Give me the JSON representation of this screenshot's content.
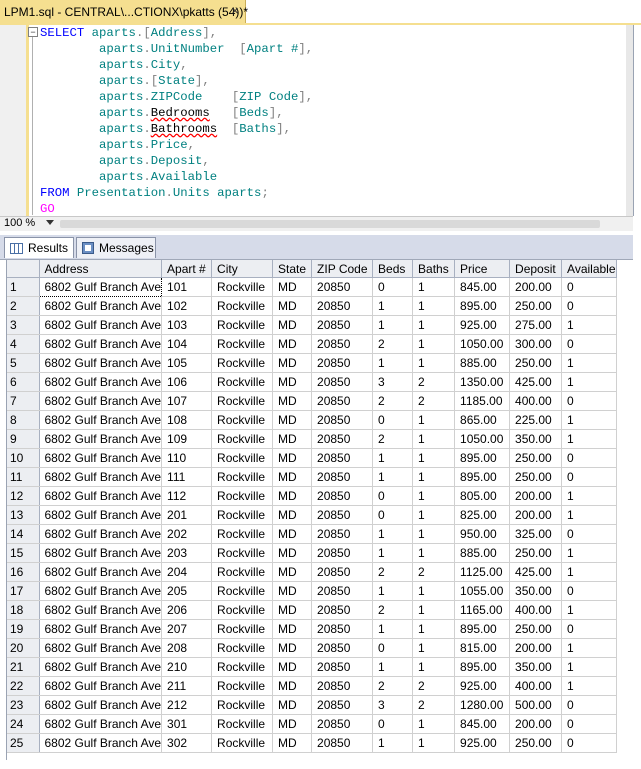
{
  "document_tab": {
    "title": "LPM1.sql - CENTRAL\\...CTIONX\\pkatts (54))*",
    "close_glyph": "×"
  },
  "editor": {
    "collapse_glyph": "−",
    "lines": [
      [
        [
          "kw",
          "SELECT "
        ],
        [
          "id",
          "aparts"
        ],
        [
          "pun",
          "."
        ],
        [
          "pun",
          "["
        ],
        [
          "id",
          "Address"
        ],
        [
          "pun",
          "],"
        ]
      ],
      [
        [
          "",
          "        "
        ],
        [
          "id",
          "aparts"
        ],
        [
          "pun",
          "."
        ],
        [
          "id",
          "UnitNumber"
        ],
        [
          "",
          "  "
        ],
        [
          "pun",
          "["
        ],
        [
          "id",
          "Apart #"
        ],
        [
          "pun",
          "],"
        ]
      ],
      [
        [
          "",
          "        "
        ],
        [
          "id",
          "aparts"
        ],
        [
          "pun",
          "."
        ],
        [
          "id",
          "City"
        ],
        [
          "pun",
          ","
        ]
      ],
      [
        [
          "",
          "        "
        ],
        [
          "id",
          "aparts"
        ],
        [
          "pun",
          "."
        ],
        [
          "pun",
          "["
        ],
        [
          "id",
          "State"
        ],
        [
          "pun",
          "],"
        ]
      ],
      [
        [
          "",
          "        "
        ],
        [
          "id",
          "aparts"
        ],
        [
          "pun",
          "."
        ],
        [
          "id",
          "ZIPCode"
        ],
        [
          "",
          "    "
        ],
        [
          "pun",
          "["
        ],
        [
          "id",
          "ZIP Code"
        ],
        [
          "pun",
          "],"
        ]
      ],
      [
        [
          "",
          "        "
        ],
        [
          "id",
          "aparts"
        ],
        [
          "pun",
          "."
        ],
        [
          "sq",
          "Bedrooms"
        ],
        [
          "",
          "   "
        ],
        [
          "pun",
          "["
        ],
        [
          "id",
          "Beds"
        ],
        [
          "pun",
          "],"
        ]
      ],
      [
        [
          "",
          "        "
        ],
        [
          "id",
          "aparts"
        ],
        [
          "pun",
          "."
        ],
        [
          "sq",
          "Bathrooms"
        ],
        [
          "",
          "  "
        ],
        [
          "pun",
          "["
        ],
        [
          "id",
          "Baths"
        ],
        [
          "pun",
          "],"
        ]
      ],
      [
        [
          "",
          "        "
        ],
        [
          "id",
          "aparts"
        ],
        [
          "pun",
          "."
        ],
        [
          "id",
          "Price"
        ],
        [
          "pun",
          ","
        ]
      ],
      [
        [
          "",
          "        "
        ],
        [
          "id",
          "aparts"
        ],
        [
          "pun",
          "."
        ],
        [
          "id",
          "Deposit"
        ],
        [
          "pun",
          ","
        ]
      ],
      [
        [
          "",
          "        "
        ],
        [
          "id",
          "aparts"
        ],
        [
          "pun",
          "."
        ],
        [
          "id",
          "Available"
        ]
      ],
      [
        [
          "kw",
          "FROM "
        ],
        [
          "id",
          "Presentation"
        ],
        [
          "pun",
          "."
        ],
        [
          "id",
          "Units"
        ],
        [
          "",
          " "
        ],
        [
          "id",
          "aparts"
        ],
        [
          "pun",
          ";"
        ]
      ],
      [
        [
          "kw2",
          "GO"
        ]
      ]
    ]
  },
  "zoom": {
    "value": "100 %"
  },
  "result_tabs": [
    {
      "label": "Results",
      "active": true
    },
    {
      "label": "Messages",
      "active": false
    }
  ],
  "grid": {
    "columns": [
      "",
      "Address",
      "Apart #",
      "City",
      "State",
      "ZIP Code",
      "Beds",
      "Baths",
      "Price",
      "Deposit",
      "Available"
    ],
    "rows": [
      [
        "1",
        "6802 Gulf Branch Ave",
        "101",
        "Rockville",
        "MD",
        "20850",
        "0",
        "1",
        "845.00",
        "200.00",
        "0"
      ],
      [
        "2",
        "6802 Gulf Branch Ave",
        "102",
        "Rockville",
        "MD",
        "20850",
        "1",
        "1",
        "895.00",
        "250.00",
        "0"
      ],
      [
        "3",
        "6802 Gulf Branch Ave",
        "103",
        "Rockville",
        "MD",
        "20850",
        "1",
        "1",
        "925.00",
        "275.00",
        "1"
      ],
      [
        "4",
        "6802 Gulf Branch Ave",
        "104",
        "Rockville",
        "MD",
        "20850",
        "2",
        "1",
        "1050.00",
        "300.00",
        "0"
      ],
      [
        "5",
        "6802 Gulf Branch Ave",
        "105",
        "Rockville",
        "MD",
        "20850",
        "1",
        "1",
        "885.00",
        "250.00",
        "1"
      ],
      [
        "6",
        "6802 Gulf Branch Ave",
        "106",
        "Rockville",
        "MD",
        "20850",
        "3",
        "2",
        "1350.00",
        "425.00",
        "1"
      ],
      [
        "7",
        "6802 Gulf Branch Ave",
        "107",
        "Rockville",
        "MD",
        "20850",
        "2",
        "2",
        "1185.00",
        "400.00",
        "0"
      ],
      [
        "8",
        "6802 Gulf Branch Ave",
        "108",
        "Rockville",
        "MD",
        "20850",
        "0",
        "1",
        "865.00",
        "225.00",
        "1"
      ],
      [
        "9",
        "6802 Gulf Branch Ave",
        "109",
        "Rockville",
        "MD",
        "20850",
        "2",
        "1",
        "1050.00",
        "350.00",
        "1"
      ],
      [
        "10",
        "6802 Gulf Branch Ave",
        "110",
        "Rockville",
        "MD",
        "20850",
        "1",
        "1",
        "895.00",
        "250.00",
        "0"
      ],
      [
        "11",
        "6802 Gulf Branch Ave",
        "111",
        "Rockville",
        "MD",
        "20850",
        "1",
        "1",
        "895.00",
        "250.00",
        "0"
      ],
      [
        "12",
        "6802 Gulf Branch Ave",
        "112",
        "Rockville",
        "MD",
        "20850",
        "0",
        "1",
        "805.00",
        "200.00",
        "1"
      ],
      [
        "13",
        "6802 Gulf Branch Ave",
        "201",
        "Rockville",
        "MD",
        "20850",
        "0",
        "1",
        "825.00",
        "200.00",
        "1"
      ],
      [
        "14",
        "6802 Gulf Branch Ave",
        "202",
        "Rockville",
        "MD",
        "20850",
        "1",
        "1",
        "950.00",
        "325.00",
        "0"
      ],
      [
        "15",
        "6802 Gulf Branch Ave",
        "203",
        "Rockville",
        "MD",
        "20850",
        "1",
        "1",
        "885.00",
        "250.00",
        "1"
      ],
      [
        "16",
        "6802 Gulf Branch Ave",
        "204",
        "Rockville",
        "MD",
        "20850",
        "2",
        "2",
        "1125.00",
        "425.00",
        "1"
      ],
      [
        "17",
        "6802 Gulf Branch Ave",
        "205",
        "Rockville",
        "MD",
        "20850",
        "1",
        "1",
        "1055.00",
        "350.00",
        "0"
      ],
      [
        "18",
        "6802 Gulf Branch Ave",
        "206",
        "Rockville",
        "MD",
        "20850",
        "2",
        "1",
        "1165.00",
        "400.00",
        "1"
      ],
      [
        "19",
        "6802 Gulf Branch Ave",
        "207",
        "Rockville",
        "MD",
        "20850",
        "1",
        "1",
        "895.00",
        "250.00",
        "0"
      ],
      [
        "20",
        "6802 Gulf Branch Ave",
        "208",
        "Rockville",
        "MD",
        "20850",
        "0",
        "1",
        "815.00",
        "200.00",
        "1"
      ],
      [
        "21",
        "6802 Gulf Branch Ave",
        "210",
        "Rockville",
        "MD",
        "20850",
        "1",
        "1",
        "895.00",
        "350.00",
        "1"
      ],
      [
        "22",
        "6802 Gulf Branch Ave",
        "211",
        "Rockville",
        "MD",
        "20850",
        "2",
        "2",
        "925.00",
        "400.00",
        "1"
      ],
      [
        "23",
        "6802 Gulf Branch Ave",
        "212",
        "Rockville",
        "MD",
        "20850",
        "3",
        "2",
        "1280.00",
        "500.00",
        "0"
      ],
      [
        "24",
        "6802 Gulf Branch Ave",
        "301",
        "Rockville",
        "MD",
        "20850",
        "0",
        "1",
        "845.00",
        "200.00",
        "0"
      ],
      [
        "25",
        "6802 Gulf Branch Ave",
        "302",
        "Rockville",
        "MD",
        "20850",
        "1",
        "1",
        "925.00",
        "250.00",
        "0"
      ]
    ]
  }
}
